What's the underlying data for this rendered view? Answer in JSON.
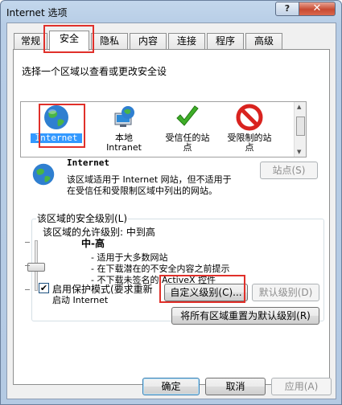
{
  "window": {
    "title": "Internet 选项",
    "help_label": "?",
    "close_label": "✕"
  },
  "tabs": [
    {
      "label": "常规"
    },
    {
      "label": "安全"
    },
    {
      "label": "隐私"
    },
    {
      "label": "内容"
    },
    {
      "label": "连接"
    },
    {
      "label": "程序"
    },
    {
      "label": "高级"
    }
  ],
  "active_tab": "安全",
  "zones": {
    "prompt": "选择一个区域以查看或更改安全设",
    "items": [
      {
        "label": "Internet",
        "icon": "globe-icon",
        "selected": true
      },
      {
        "label": "本地\nIntranet",
        "icon": "intranet-icon"
      },
      {
        "label": "受信任的站\n点",
        "icon": "trusted-check-icon"
      },
      {
        "label": "受限制的站\n点",
        "icon": "restricted-icon"
      }
    ]
  },
  "zone_info": {
    "name": "Internet",
    "desc_line1": "该区域适用于 Internet 网站，但不适用于",
    "desc_line2": "在受信任和受限制区域中列出的网站。",
    "sites_button": "站点(S)"
  },
  "security": {
    "group_label": "该区域的安全级别(L)",
    "allowed_levels": "该区域的允许级别: 中到高",
    "level_name": "中-高",
    "bullets": [
      "- 适用于大多数网站",
      "- 在下载潜在的不安全内容之前提示",
      "- 不下载未签名的 ActiveX 控件"
    ],
    "protected_mode_line1": "启用保护模式(要求重新",
    "protected_mode_line2": "启动 Internet",
    "protected_mode_checked": true,
    "custom_button": "自定义级别(C)...",
    "default_button": "默认级别(D)",
    "reset_all_button": "将所有区域重置为默认级别(R)"
  },
  "footer": {
    "ok": "确定",
    "cancel": "取消",
    "apply": "应用(A)"
  },
  "colors": {
    "highlight_box": "#e0302a",
    "selection": "#3399ff"
  }
}
